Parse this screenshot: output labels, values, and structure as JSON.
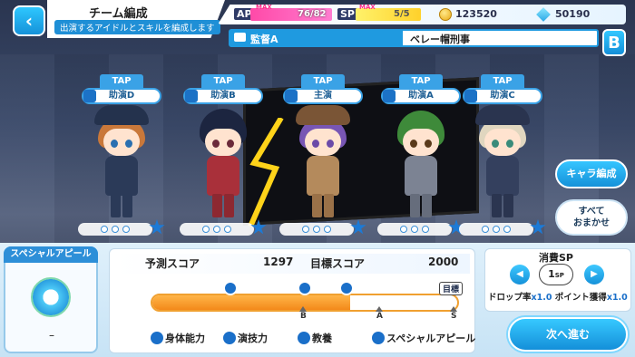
{
  "header": {
    "back_label": "‹",
    "title": "チーム編成",
    "subtitle": "出演するアイドルとスキルを編成します"
  },
  "status": {
    "ap_label": "AP",
    "ap_max_tag": "MAX",
    "ap_value": "76/82",
    "sp_label": "SP",
    "sp_max_tag": "MAX",
    "sp_value": "5/5",
    "coins": "123520",
    "gems": "50190",
    "coin_icon": "coin-icon",
    "gem_icon": "gem-icon"
  },
  "director": {
    "label": "監督A",
    "value": "ベレー帽刑事",
    "badge": "B"
  },
  "slots": [
    {
      "tap": "TAP",
      "role": "助演D"
    },
    {
      "tap": "TAP",
      "role": "助演B"
    },
    {
      "tap": "TAP",
      "role": "主演"
    },
    {
      "tap": "TAP",
      "role": "助演A"
    },
    {
      "tap": "TAP",
      "role": "助演C"
    }
  ],
  "side_buttons": {
    "chara": "キャラ編成",
    "auto_line1": "すべて",
    "auto_line2": "おまかせ"
  },
  "special_appeal": {
    "title": "スペシャルアピール",
    "value": "–"
  },
  "score": {
    "predicted_label": "予測スコア",
    "predicted_value": "1297",
    "target_label": "目標スコア",
    "target_value": "2000",
    "goal_tag": "目標",
    "progress": 0.65,
    "ticks": [
      "B",
      "A",
      "S"
    ]
  },
  "legend": [
    {
      "label": "身体能力",
      "icon": "body-ability-icon"
    },
    {
      "label": "演技力",
      "icon": "acting-icon"
    },
    {
      "label": "教養",
      "icon": "culture-icon"
    },
    {
      "label": "スペシャルアピール",
      "icon": "special-appeal-icon"
    }
  ],
  "cost": {
    "title": "消費SP",
    "sp_number": "1",
    "sp_unit": "SP",
    "drop_label": "ドロップ率",
    "drop_value": "x1.0",
    "point_label": "ポイント獲得",
    "point_value": "x1.0"
  },
  "next_button": "次へ進む",
  "colors": {
    "accent": "#1f9ae0",
    "gauge": "#f3891a"
  }
}
